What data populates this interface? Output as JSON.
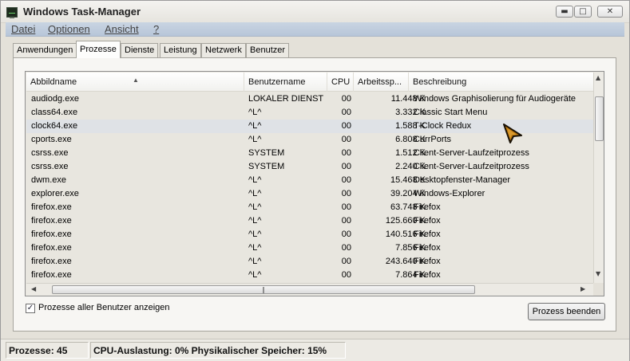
{
  "window": {
    "title": "Windows Task-Manager"
  },
  "menu": [
    "Datei",
    "Optionen",
    "Ansicht",
    "?"
  ],
  "tabs": [
    "Anwendungen",
    "Prozesse",
    "Dienste",
    "Leistung",
    "Netzwerk",
    "Benutzer"
  ],
  "active_tab": "Prozesse",
  "columns": [
    "Abbildname",
    "Benutzername",
    "CPU",
    "Arbeitssp...",
    "Beschreibung"
  ],
  "processes": [
    {
      "name": "audiodg.exe",
      "user": "LOKALER DIENST",
      "cpu": "00",
      "mem": "11.448 K",
      "desc": "Windows Graphisolierung für Audiogeräte"
    },
    {
      "name": "class64.exe",
      "user": "^L^",
      "cpu": "00",
      "mem": "3.332 K",
      "desc": "Classic Start Menu"
    },
    {
      "name": "clock64.exe",
      "user": "^L^",
      "cpu": "00",
      "mem": "1.588 K",
      "desc": "T-Clock Redux"
    },
    {
      "name": "cports.exe",
      "user": "^L^",
      "cpu": "00",
      "mem": "6.808 K",
      "desc": "CurrPorts"
    },
    {
      "name": "csrss.exe",
      "user": "SYSTEM",
      "cpu": "00",
      "mem": "1.512 K",
      "desc": "Client-Server-Laufzeitprozess"
    },
    {
      "name": "csrss.exe",
      "user": "SYSTEM",
      "cpu": "00",
      "mem": "2.240 K",
      "desc": "Client-Server-Laufzeitprozess"
    },
    {
      "name": "dwm.exe",
      "user": "^L^",
      "cpu": "00",
      "mem": "15.468 K",
      "desc": "Desktopfenster-Manager"
    },
    {
      "name": "explorer.exe",
      "user": "^L^",
      "cpu": "00",
      "mem": "39.204 K",
      "desc": "Windows-Explorer"
    },
    {
      "name": "firefox.exe",
      "user": "^L^",
      "cpu": "00",
      "mem": "63.748 K",
      "desc": "Firefox"
    },
    {
      "name": "firefox.exe",
      "user": "^L^",
      "cpu": "00",
      "mem": "125.660 K",
      "desc": "Firefox"
    },
    {
      "name": "firefox.exe",
      "user": "^L^",
      "cpu": "00",
      "mem": "140.516 K",
      "desc": "Firefox"
    },
    {
      "name": "firefox.exe",
      "user": "^L^",
      "cpu": "00",
      "mem": "7.856 K",
      "desc": "Firefox"
    },
    {
      "name": "firefox.exe",
      "user": "^L^",
      "cpu": "00",
      "mem": "243.640 K",
      "desc": "Firefox"
    },
    {
      "name": "firefox.exe",
      "user": "^L^",
      "cpu": "00",
      "mem": "7.864 K",
      "desc": "Firefox"
    }
  ],
  "selected_row": 2,
  "show_all_users": {
    "label": "Prozesse aller Benutzer anzeigen",
    "checked": true
  },
  "end_process_label": "Prozess beenden",
  "status": {
    "processes": "Prozesse: 45",
    "cpu_memory": "CPU-Auslastung: 0% Physikalischer Speicher: 15%"
  },
  "icons": {
    "app": "task-manager-icon",
    "checkbox": "checkmark-icon",
    "cursor": "mouse-pointer-icon"
  },
  "colors": {
    "menubar": "#b7c6d9",
    "selection": "#dfe2e6",
    "cursor": "#c07a0e"
  }
}
